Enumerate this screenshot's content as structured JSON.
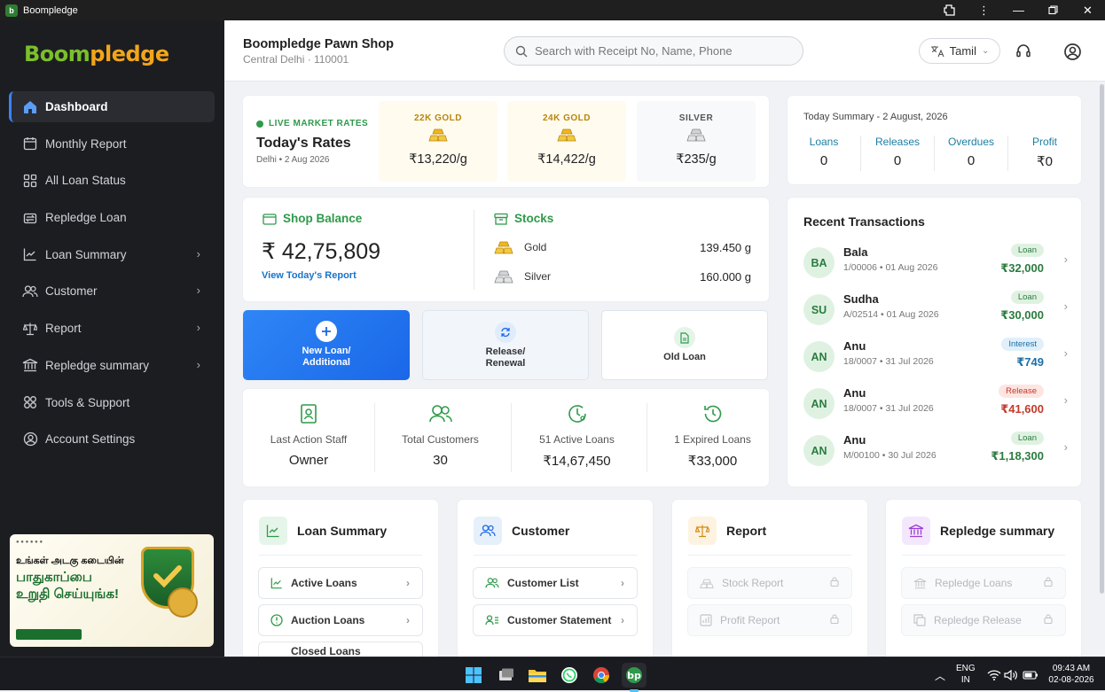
{
  "window": {
    "title": "Boompledge"
  },
  "sidebar": {
    "logo_part1": "Boom",
    "logo_part2": "pledge",
    "items": [
      {
        "label": "Dashboard"
      },
      {
        "label": "Monthly Report"
      },
      {
        "label": "All Loan Status"
      },
      {
        "label": "Repledge Loan"
      },
      {
        "label": "Loan Summary"
      },
      {
        "label": "Customer"
      },
      {
        "label": "Report"
      },
      {
        "label": "Repledge summary"
      },
      {
        "label": "Tools & Support"
      },
      {
        "label": "Account Settings"
      }
    ],
    "banner": {
      "line1": "உங்கள் அடகு கடையின்",
      "line2": "பாதுகாப்பை",
      "line3": "உறுதி செய்யுங்க!"
    }
  },
  "header": {
    "shop_name": "Boompledge Pawn Shop",
    "shop_location": "Central Delhi · 110001",
    "search_placeholder": "Search with Receipt No, Name, Phone",
    "language": "Tamil"
  },
  "rates": {
    "live_label": "LIVE MARKET RATES",
    "title": "Today's Rates",
    "subtitle": "Delhi • 2 Aug 2026",
    "items": [
      {
        "label": "22K GOLD",
        "value": "₹13,220/g"
      },
      {
        "label": "24K GOLD",
        "value": "₹14,422/g"
      },
      {
        "label": "SILVER",
        "value": "₹235/g"
      }
    ],
    "colors": {
      "gold": "#b8860b",
      "silver": "#555555"
    }
  },
  "today_summary": {
    "title": "Today Summary - 2 August, 2026",
    "cols": [
      {
        "label": "Loans",
        "value": "0"
      },
      {
        "label": "Releases",
        "value": "0"
      },
      {
        "label": "Overdues",
        "value": "0"
      },
      {
        "label": "Profit",
        "value": "₹0"
      }
    ]
  },
  "balance": {
    "title": "Shop Balance",
    "amount": "₹ 42,75,809",
    "link": "View Today's Report"
  },
  "stocks": {
    "title": "Stocks",
    "rows": [
      {
        "name": "Gold",
        "value": "139.450 g"
      },
      {
        "name": "Silver",
        "value": "160.000 g"
      }
    ]
  },
  "actions": [
    {
      "label": "New Loan/ Additional"
    },
    {
      "label": "Release/ Renewal"
    },
    {
      "label": "Old Loan"
    }
  ],
  "stats": [
    {
      "label": "Last Action Staff",
      "value": "Owner"
    },
    {
      "label": "Total Customers",
      "value": "30"
    },
    {
      "label": "51 Active Loans",
      "value": "₹14,67,450"
    },
    {
      "label": "1 Expired Loans",
      "value": "₹33,000"
    }
  ],
  "recent": {
    "title": "Recent Transactions",
    "items": [
      {
        "initials": "BA",
        "name": "Bala",
        "detail": "1/00006 • 01 Aug 2026",
        "badge": "Loan",
        "amount": "₹32,000",
        "kind": "loan"
      },
      {
        "initials": "SU",
        "name": "Sudha",
        "detail": "A/02514 • 01 Aug 2026",
        "badge": "Loan",
        "amount": "₹30,000",
        "kind": "loan"
      },
      {
        "initials": "AN",
        "name": "Anu",
        "detail": "18/0007 • 31 Jul 2026",
        "badge": "Interest",
        "amount": "₹749",
        "kind": "int"
      },
      {
        "initials": "AN",
        "name": "Anu",
        "detail": "18/0007 • 31 Jul 2026",
        "badge": "Release",
        "amount": "₹41,600",
        "kind": "rel"
      },
      {
        "initials": "AN",
        "name": "Anu",
        "detail": "M/00100 • 30 Jul 2026",
        "badge": "Loan",
        "amount": "₹1,18,300",
        "kind": "loan"
      }
    ]
  },
  "modules": [
    {
      "title": "Loan Summary",
      "links": [
        {
          "label": "Active Loans"
        },
        {
          "label": "Auction Loans"
        },
        {
          "label": "Closed Loans"
        }
      ]
    },
    {
      "title": "Customer",
      "links": [
        {
          "label": "Customer List"
        },
        {
          "label": "Customer Statement"
        }
      ]
    },
    {
      "title": "Report",
      "links": [
        {
          "label": "Stock Report"
        },
        {
          "label": "Profit Report"
        }
      ]
    },
    {
      "title": "Repledge summary",
      "links": [
        {
          "label": "Repledge Loans"
        },
        {
          "label": "Repledge Release"
        }
      ]
    }
  ],
  "taskbar": {
    "lang_line1": "ENG",
    "lang_line2": "IN",
    "time": "09:43 AM",
    "date": "02-08-2026"
  }
}
